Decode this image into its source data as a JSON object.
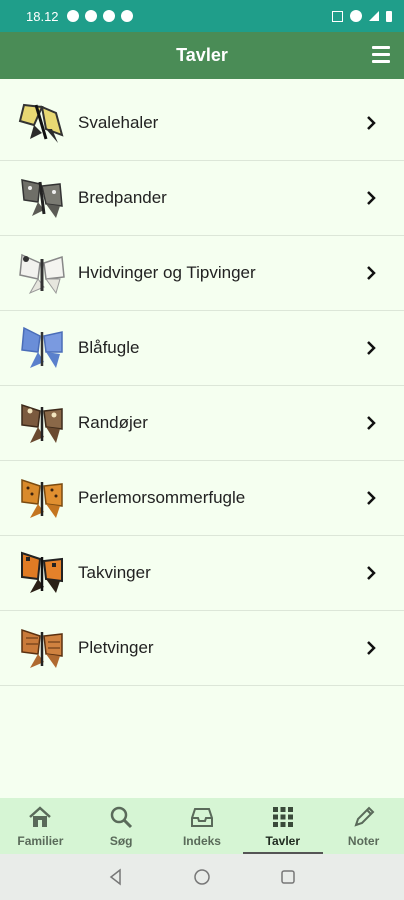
{
  "status_bar": {
    "time": "18.12"
  },
  "app_bar": {
    "title": "Tavler"
  },
  "list": [
    {
      "label": "Svalehaler",
      "icon": "swallowtail-icon",
      "color": "#e8d873"
    },
    {
      "label": "Bredpander",
      "icon": "skipper-icon",
      "color": "#6f6f68"
    },
    {
      "label": "Hvidvinger og Tipvinger",
      "icon": "white-butterfly-icon",
      "color": "#eeeeea"
    },
    {
      "label": "Blåfugle",
      "icon": "blue-butterfly-icon",
      "color": "#6a8ed8"
    },
    {
      "label": "Randøjer",
      "icon": "ringlet-icon",
      "color": "#7b5a3e"
    },
    {
      "label": "Perlemorsommerfugle",
      "icon": "fritillary-icon",
      "color": "#d98a2b"
    },
    {
      "label": "Takvinger",
      "icon": "tortoiseshell-icon",
      "color": "#e07b24"
    },
    {
      "label": "Pletvinger",
      "icon": "checkerspot-icon",
      "color": "#c97a3a"
    }
  ],
  "bottom_nav": [
    {
      "label": "Familier",
      "icon": "home-icon"
    },
    {
      "label": "Søg",
      "icon": "search-icon"
    },
    {
      "label": "Indeks",
      "icon": "inbox-icon"
    },
    {
      "label": "Tavler",
      "icon": "grid-icon",
      "active": true
    },
    {
      "label": "Noter",
      "icon": "pencil-icon"
    }
  ],
  "colors": {
    "status": "#1f9e8a",
    "appbar": "#4a8c56",
    "background": "#f5fff0",
    "bottom_nav": "#d6f5d4"
  }
}
